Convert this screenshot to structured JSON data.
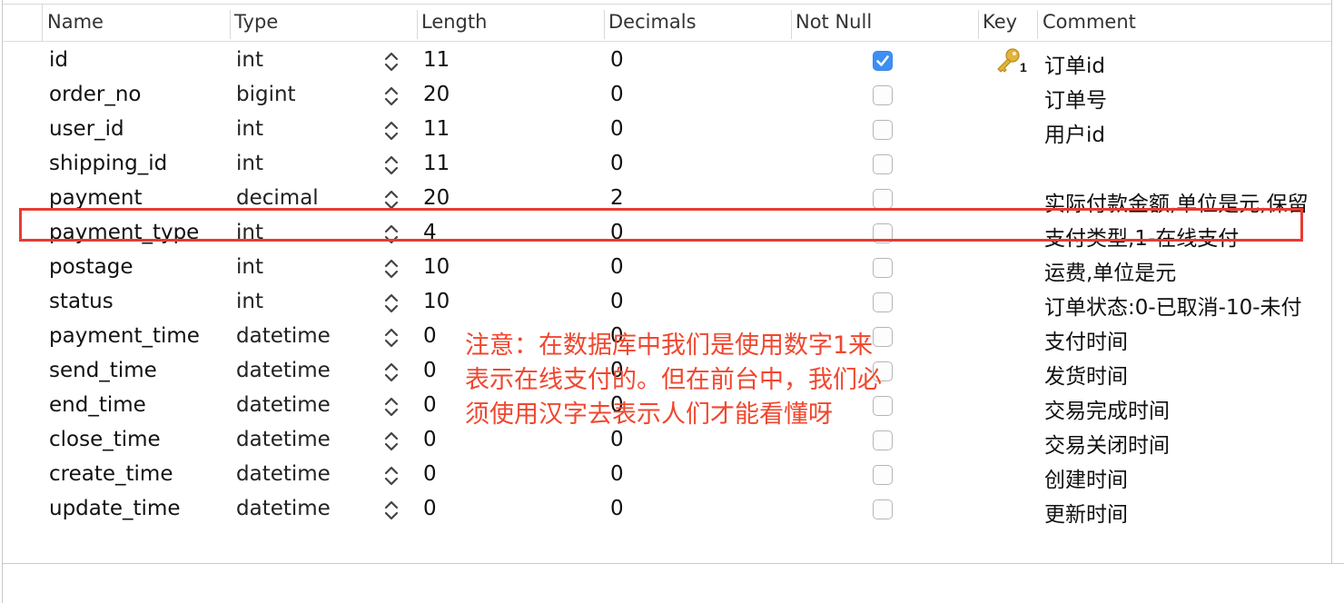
{
  "columns": {
    "name": "Name",
    "type": "Type",
    "length": "Length",
    "decimals": "Decimals",
    "not_null": "Not Null",
    "key": "Key",
    "comment": "Comment"
  },
  "rows": [
    {
      "name": "id",
      "type": "int",
      "length": "11",
      "decimals": "0",
      "not_null": true,
      "key": "1",
      "comment": "订单id"
    },
    {
      "name": "order_no",
      "type": "bigint",
      "length": "20",
      "decimals": "0",
      "not_null": false,
      "comment": "订单号"
    },
    {
      "name": "user_id",
      "type": "int",
      "length": "11",
      "decimals": "0",
      "not_null": false,
      "comment": "用户id"
    },
    {
      "name": "shipping_id",
      "type": "int",
      "length": "11",
      "decimals": "0",
      "not_null": false,
      "comment": ""
    },
    {
      "name": "payment",
      "type": "decimal",
      "length": "20",
      "decimals": "2",
      "not_null": false,
      "comment": "实际付款金额,单位是元,保留"
    },
    {
      "name": "payment_type",
      "type": "int",
      "length": "4",
      "decimals": "0",
      "not_null": false,
      "comment": "支付类型,1-在线支付"
    },
    {
      "name": "postage",
      "type": "int",
      "length": "10",
      "decimals": "0",
      "not_null": false,
      "comment": "运费,单位是元"
    },
    {
      "name": "status",
      "type": "int",
      "length": "10",
      "decimals": "0",
      "not_null": false,
      "comment": "订单状态:0-已取消-10-未付"
    },
    {
      "name": "payment_time",
      "type": "datetime",
      "length": "0",
      "decimals": "0",
      "not_null": false,
      "comment": "支付时间"
    },
    {
      "name": "send_time",
      "type": "datetime",
      "length": "0",
      "decimals": "0",
      "not_null": false,
      "comment": "发货时间"
    },
    {
      "name": "end_time",
      "type": "datetime",
      "length": "0",
      "decimals": "0",
      "not_null": false,
      "comment": "交易完成时间"
    },
    {
      "name": "close_time",
      "type": "datetime",
      "length": "0",
      "decimals": "0",
      "not_null": false,
      "comment": "交易关闭时间"
    },
    {
      "name": "create_time",
      "type": "datetime",
      "length": "0",
      "decimals": "0",
      "not_null": false,
      "comment": "创建时间"
    },
    {
      "name": "update_time",
      "type": "datetime",
      "length": "0",
      "decimals": "0",
      "not_null": false,
      "comment": "更新时间"
    }
  ],
  "annotation": {
    "lines": [
      "注意：在数据库中我们是使用数字1来",
      "表示在线支付的。但在前台中，我们必",
      "须使用汉字去表示人们才能看懂呀"
    ]
  },
  "icons": {
    "key": "key-icon",
    "stepper": "stepper-icon",
    "checkbox": "checkbox"
  },
  "colors": {
    "highlight": "#e83b32",
    "annotation": "#f0472f",
    "checkbox_checked": "#3d8ff5",
    "key_gold": "#e3b43a"
  }
}
